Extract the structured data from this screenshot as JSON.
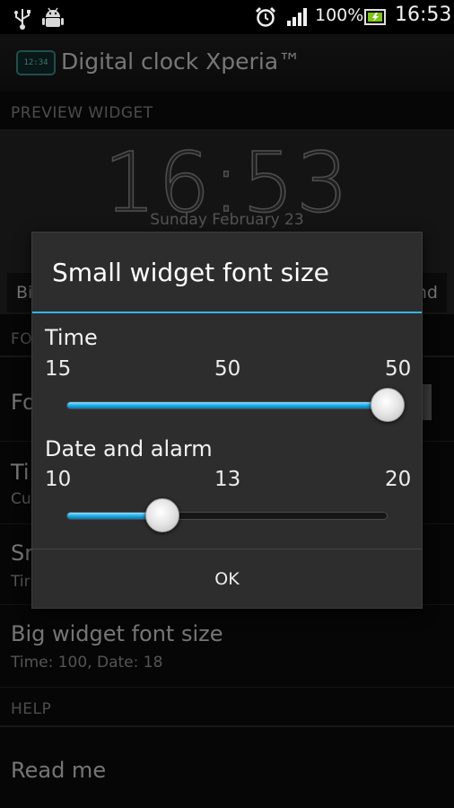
{
  "status_bar": {
    "battery_text": "100%",
    "time": "16:53"
  },
  "action_bar": {
    "icon_text": "12:34",
    "title": "Digital clock Xperia™"
  },
  "preview": {
    "section_label": "PREVIEW WIDGET",
    "time": "16:53",
    "date": "Sunday February 23",
    "left_button": "Bi",
    "right_button": "nd"
  },
  "settings": {
    "section_label_partial": "FO",
    "row1_title_partial": "Fo",
    "row2_title_partial": "Ti",
    "row2_sub_partial": "Cu",
    "row3_title_partial": "Sr",
    "row3_sub_partial": "Tir",
    "big_font_title": "Big widget font size",
    "big_font_sub": "Time: 100, Date: 18",
    "help_label": "HELP",
    "read_me": "Read me"
  },
  "dialog": {
    "title": "Small widget font size",
    "time_slider": {
      "label": "Time",
      "min_label": "15",
      "value_label": "50",
      "max_label": "50",
      "min": 15,
      "max": 50,
      "value": 50
    },
    "date_slider": {
      "label": "Date and alarm",
      "min_label": "10",
      "value_label": "13",
      "max_label": "20",
      "min": 10,
      "max": 20,
      "value": 13
    },
    "ok_label": "OK"
  },
  "colors": {
    "accent": "#33b5e5",
    "dialog_bg": "#2d2d2d",
    "background": "#0c0c0c"
  },
  "icons": [
    "usb-icon",
    "android-debug-icon",
    "alarm-clock-icon",
    "signal-icon",
    "battery-charging-icon"
  ]
}
